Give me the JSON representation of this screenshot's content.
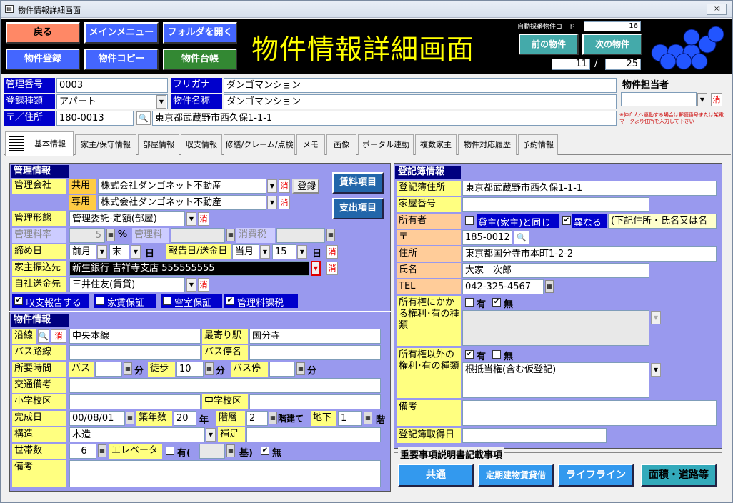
{
  "window": {
    "title": "物件情報詳細画面",
    "close": "☒"
  },
  "header": {
    "back": "戻る",
    "main_menu": "メインメニュー",
    "open_folder": "フォルダを開く",
    "register": "物件登録",
    "copy": "物件コピー",
    "ledger": "物件台帳",
    "title": "物件情報詳細画面",
    "auto_code_label": "自動採番物件コード",
    "auto_code": "16",
    "prev": "前の物件",
    "next": "次の物件",
    "page_cur": "11",
    "page_sep": "/",
    "page_total": "25"
  },
  "top": {
    "kanri_label": "管理番号",
    "kanri_value": "0003",
    "furigana_label": "フリガナ",
    "furigana_value": "ダンゴマンション",
    "toroku_label": "登録種類",
    "toroku_value": "アパート",
    "name_label": "物件名称",
    "name_value": "ダンゴマンション",
    "zip_label": "〒／住所",
    "zip_value": "180-0013",
    "address_value": "東京都武蔵野市西久保1-1-1",
    "tanto_label": "物件担当者",
    "note": "※仲介人へ連動する場合は郵便番号または架電マークより住所を入力して下さい",
    "x": "消"
  },
  "tabs": [
    "基本情報",
    "家主/保守情報",
    "部屋情報",
    "収支情報",
    "修繕/クレーム/点検",
    "メモ",
    "画像",
    "ポータル連動",
    "複数家主",
    "物件対応履歴",
    "予約情報"
  ],
  "kanri": {
    "section": "管理情報",
    "company_label": "管理会社",
    "kyoyo": "共用",
    "kyoyo_value": "株式会社ダンゴネット不動産",
    "senyo": "専用",
    "senyo_value": "株式会社ダンゴネット不動産",
    "register_btn": "登録",
    "keitai_label": "管理形態",
    "keitai_value": "管理委託-定額(部屋)",
    "ryoritsu_label": "管理料率",
    "ryoritsu_value": "5",
    "percent": "%",
    "kanriryo_label": "管理料",
    "shohizei_label": "消費税",
    "shime_label": "締め日",
    "shime_month": "前月",
    "shime_day": "末",
    "day_unit": "日",
    "report_label": "報告日/送金日",
    "report_month": "当月",
    "report_day": "15",
    "furikomi_label": "家主振込先",
    "furikomi_value": "新生銀行 吉祥寺支店 555555555",
    "jisha_label": "自社送金先",
    "jisha_value": "三井住友(賃貸)",
    "cb1": "収支報告する",
    "cb2": "家賃保証",
    "cb3": "空室保証",
    "cb4": "管理料課税",
    "shiryo_btn": "賃料項目",
    "shishutsu_btn": "支出項目"
  },
  "bukken": {
    "section": "物件情報",
    "ensen_label": "沿線",
    "ensen_value": "中央本線",
    "eki_label": "最寄り駅",
    "eki_value": "国分寺",
    "bus_label": "バス路線",
    "busstop_label": "バス停名",
    "time_label": "所要時間",
    "bus": "バス",
    "walk": "徒歩",
    "walk_value": "10",
    "min": "分",
    "busstop2": "バス停",
    "kotsu_label": "交通備考",
    "school_label": "小学校区",
    "jschool_label": "中学校区",
    "kansei_label": "完成日",
    "kansei_value": "00/08/01",
    "chikunen_label": "築年数",
    "chikunen_value": "20",
    "year": "年",
    "kaiso_label": "階層",
    "kaiso_value": "2",
    "kaidate": "階建て",
    "chika_label": "地下",
    "chika_value": "1",
    "kai": "階",
    "kozo_label": "構造",
    "kozo_value": "木造",
    "hosoku_label": "補足",
    "setai_label": "世帯数",
    "setai_value": "6",
    "elevator_label": "エレベータ",
    "ari": "有(",
    "ki": "基)",
    "nashi": "無",
    "biko_label": "備考"
  },
  "toki": {
    "section": "登記簿情報",
    "addr_label": "登記簿住所",
    "addr_value": "東京都武蔵野市西久保1-1-1",
    "kaoku_label": "家屋番号",
    "owner_label": "所有者",
    "same_label": "貸主(家主)と同じ",
    "diff_label": "異なる",
    "diff_note": "(下記住所・氏名又は名",
    "zip_label": "〒",
    "zip_value": "185-0012",
    "jusho_label": "住所",
    "jusho_value": "東京都国分寺市本町1-2-2",
    "name_label": "氏名",
    "name_value": "大家　次郎",
    "tel_label": "TEL",
    "tel_value": "042-325-4567",
    "kenri_label": "所有権にかかる権利･有の種類",
    "ari": "有",
    "nashi": "無",
    "kenri2_label": "所有権以外の権利･有の種類",
    "kenri2_value": "根抵当権(含む仮登記)",
    "biko_label": "備考",
    "date_label": "登記簿取得日"
  },
  "juyo": {
    "section": "重要事項説明書記載事項",
    "btn1": "共通",
    "btn2": "定期建物賃貸借",
    "btn3": "ライフライン",
    "btn4": "面積・道路等"
  }
}
